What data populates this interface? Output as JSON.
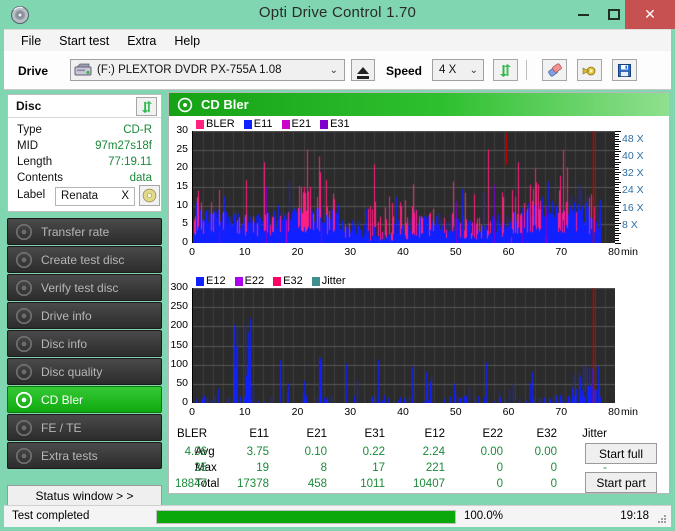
{
  "window": {
    "title": "Opti Drive Control 1.70",
    "app_icon": "disc-icon",
    "minimize": "minimize-icon",
    "maximize": "maximize-icon",
    "close": "✕"
  },
  "menu": {
    "items": [
      {
        "label": "File"
      },
      {
        "label": "Start test"
      },
      {
        "label": "Extra"
      },
      {
        "label": "Help"
      }
    ]
  },
  "toolbar": {
    "drive_label": "Drive",
    "drive_value": "(F:)  PLEXTOR DVDR  PX-755A 1.08",
    "dropdown_arrow": "⌄",
    "eject_title": "Eject",
    "speed_label": "Speed",
    "speed_value": "4 X",
    "refresh_icon": "refresh-icon",
    "erase_icon": "erase-icon",
    "settings_icon": "settings-icon",
    "save_icon": "save-icon"
  },
  "disc": {
    "header": "Disc",
    "refresh_icon": "refresh-icon",
    "rows": [
      {
        "key": "Type",
        "value": "CD-R"
      },
      {
        "key": "MID",
        "value": "97m27s18f"
      },
      {
        "key": "Length",
        "value": "77:19.11"
      },
      {
        "key": "Contents",
        "value": "data"
      }
    ],
    "label_key": "Label",
    "label_value": "Renata",
    "label_clear": "X",
    "label_button_icon": "disc-icon"
  },
  "sidebar": {
    "items": [
      {
        "label": "Transfer rate",
        "icon": "disc-icon",
        "active": false
      },
      {
        "label": "Create test disc",
        "icon": "disc-icon",
        "active": false
      },
      {
        "label": "Verify test disc",
        "icon": "disc-icon",
        "active": false
      },
      {
        "label": "Drive info",
        "icon": "disc-icon",
        "active": false
      },
      {
        "label": "Disc info",
        "icon": "disc-icon",
        "active": false
      },
      {
        "label": "Disc quality",
        "icon": "disc-icon",
        "active": false
      },
      {
        "label": "CD Bler",
        "icon": "disc-icon",
        "active": true
      },
      {
        "label": "FE / TE",
        "icon": "disc-icon",
        "active": false
      },
      {
        "label": "Extra tests",
        "icon": "disc-icon",
        "active": false
      }
    ],
    "status_window_button": "Status window > >"
  },
  "main": {
    "header_title": "CD Bler",
    "header_icon": "disc-icon",
    "start_full": "Start full",
    "start_part": "Start part"
  },
  "stats": {
    "columns": [
      "BLER",
      "E11",
      "E21",
      "E31",
      "E12",
      "E22",
      "E32",
      "Jitter"
    ],
    "rows": [
      {
        "label": "Avg",
        "values": [
          "4.06",
          "3.75",
          "0.10",
          "0.22",
          "2.24",
          "0.00",
          "0.00",
          "-"
        ]
      },
      {
        "label": "Max",
        "values": [
          "25",
          "19",
          "8",
          "17",
          "221",
          "0",
          "0",
          "-"
        ]
      },
      {
        "label": "Total",
        "values": [
          "18847",
          "17378",
          "458",
          "1011",
          "10407",
          "0",
          "0",
          ""
        ]
      }
    ]
  },
  "statusbar": {
    "text": "Test completed",
    "progress_percent": "100.0%",
    "progress_value": 100,
    "time": "19:18"
  },
  "chart_data": [
    {
      "type": "line",
      "id": "cd-bler-chart",
      "title": "CD Bler",
      "xlabel": "min",
      "ylabel": "",
      "xlim": [
        0,
        80
      ],
      "ylim": [
        0,
        30
      ],
      "xticks": [
        0,
        10,
        20,
        30,
        40,
        50,
        60,
        70,
        80
      ],
      "yticks": [
        0,
        5,
        10,
        15,
        20,
        25,
        30
      ],
      "right_axis": {
        "label": "X",
        "ticks": [
          "8 X",
          "16 X",
          "24 X",
          "32 X",
          "40 X",
          "48 X"
        ],
        "values": [
          8,
          16,
          24,
          32,
          40,
          48
        ],
        "lim": [
          0,
          52
        ],
        "color": "#cc0000"
      },
      "grid": true,
      "background": "#2a2a2a",
      "legend_position": "top-left",
      "legend": [
        {
          "name": "BLER",
          "color": "#ff2080"
        },
        {
          "name": "E11",
          "color": "#1020ff"
        },
        {
          "name": "E21",
          "color": "#cc00cc"
        },
        {
          "name": "E31",
          "color": "#8000d0"
        }
      ],
      "series": [
        {
          "name": "BLER",
          "color": "#ff2080",
          "avg": 4.06,
          "max": 25,
          "total": 18847
        },
        {
          "name": "E11",
          "color": "#1020ff",
          "avg": 3.75,
          "max": 19,
          "total": 17378
        },
        {
          "name": "E21",
          "color": "#cc00cc",
          "avg": 0.1,
          "max": 8,
          "total": 458
        },
        {
          "name": "E31",
          "color": "#8000d0",
          "avg": 0.22,
          "max": 17,
          "total": 1011
        }
      ]
    },
    {
      "type": "line",
      "id": "cd-e12-chart",
      "title": "",
      "xlabel": "min",
      "ylabel": "",
      "xlim": [
        0,
        80
      ],
      "ylim": [
        0,
        300
      ],
      "xticks": [
        0,
        10,
        20,
        30,
        40,
        50,
        60,
        70,
        80
      ],
      "yticks": [
        0,
        50,
        100,
        150,
        200,
        250,
        300
      ],
      "grid": true,
      "background": "#2a2a2a",
      "legend_position": "top-left",
      "legend": [
        {
          "name": "E12",
          "color": "#1020ff"
        },
        {
          "name": "E22",
          "color": "#aa00ee"
        },
        {
          "name": "E32",
          "color": "#ff0066"
        },
        {
          "name": "Jitter",
          "color": "#3f8f8f"
        }
      ],
      "series": [
        {
          "name": "E12",
          "color": "#1020ff",
          "avg": 2.24,
          "max": 221,
          "total": 10407
        },
        {
          "name": "E22",
          "color": "#aa00ee",
          "avg": 0.0,
          "max": 0,
          "total": 0
        },
        {
          "name": "E32",
          "color": "#ff0066",
          "avg": 0.0,
          "max": 0,
          "total": 0
        },
        {
          "name": "Jitter",
          "color": "#3f8f8f",
          "avg": "-",
          "max": "-",
          "total": ""
        }
      ]
    }
  ]
}
